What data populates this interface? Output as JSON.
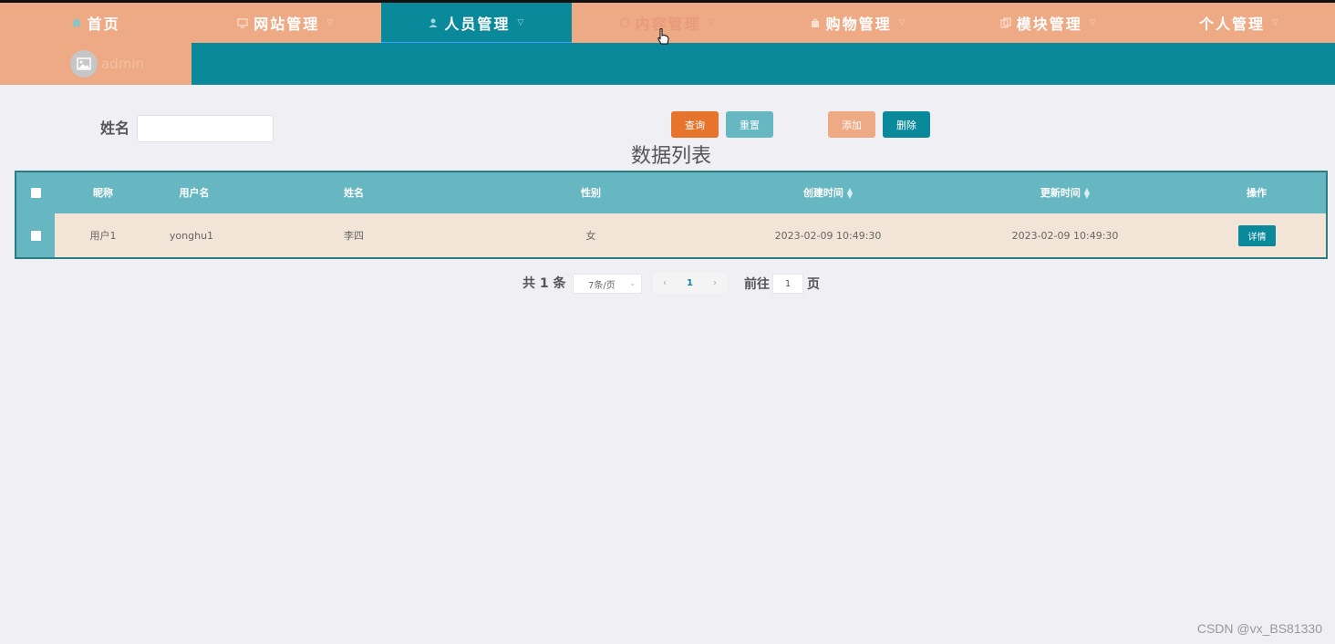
{
  "nav": {
    "items": [
      {
        "label": "首页",
        "icon": "home-icon",
        "state": "normal",
        "has_dropdown": false
      },
      {
        "label": "网站管理",
        "icon": "monitor-icon",
        "state": "normal",
        "has_dropdown": true
      },
      {
        "label": "人员管理",
        "icon": "user-icon",
        "state": "active",
        "has_dropdown": true
      },
      {
        "label": "内容管理",
        "icon": "chat-icon",
        "state": "dim",
        "has_dropdown": true
      },
      {
        "label": "购物管理",
        "icon": "bag-icon",
        "state": "normal",
        "has_dropdown": true
      },
      {
        "label": "模块管理",
        "icon": "copy-icon",
        "state": "normal",
        "has_dropdown": true
      },
      {
        "label": "个人管理",
        "icon": "",
        "state": "normal",
        "has_dropdown": true
      }
    ],
    "colors": {
      "bar": "#eeaa84",
      "active": "#09899a"
    }
  },
  "user": {
    "name": "admin",
    "avatar_icon": "image-icon"
  },
  "search": {
    "label": "姓名",
    "value": "",
    "placeholder": "",
    "query_label": "查询",
    "reset_label": "重置",
    "add_label": "添加",
    "delete_label": "删除"
  },
  "list": {
    "title": "数据列表",
    "columns": [
      "昵称",
      "用户名",
      "姓名",
      "性别",
      "创建时间",
      "更新时间",
      "操作"
    ],
    "rows": [
      {
        "nickname": "用户1",
        "username": "yonghu1",
        "name": "李四",
        "gender": "女",
        "created": "2023-02-09 10:49:30",
        "updated": "2023-02-09 10:49:30",
        "action": "详情"
      }
    ]
  },
  "pagination": {
    "total_text": "共 1 条",
    "page_size": "7条/页",
    "current_page": "1",
    "goto_label": "前往",
    "goto_value": "1",
    "page_unit": "页"
  },
  "watermark": "CSDN @vx_BS81330"
}
